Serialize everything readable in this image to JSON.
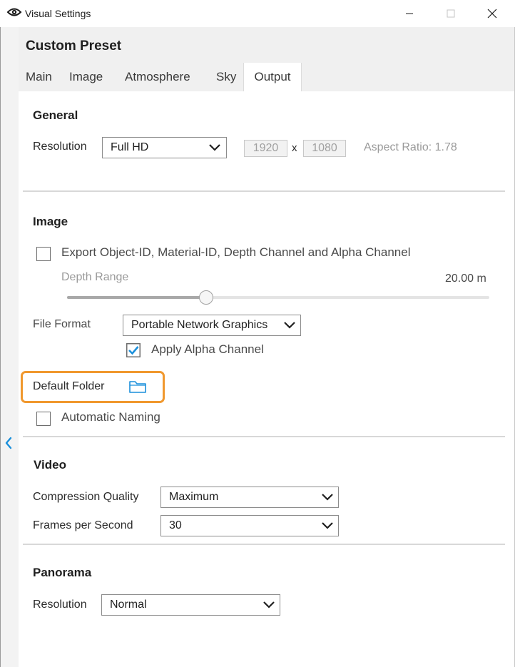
{
  "window": {
    "title": "Visual Settings",
    "icons": {
      "app": "eye-gear-icon",
      "minimize": "minimize-icon",
      "maximize": "maximize-icon",
      "close": "close-icon"
    }
  },
  "header": {
    "preset_title": "Custom Preset"
  },
  "tabs": [
    {
      "label": "Main",
      "active": false
    },
    {
      "label": "Image",
      "active": false
    },
    {
      "label": "Atmosphere",
      "active": false
    },
    {
      "label": "Sky",
      "active": false
    },
    {
      "label": "Output",
      "active": true
    }
  ],
  "general": {
    "heading": "General",
    "resolution_label": "Resolution",
    "resolution_value": "Full HD",
    "width": "1920",
    "times": "x",
    "height": "1080",
    "aspect_ratio": "Aspect Ratio: 1.78"
  },
  "image": {
    "heading": "Image",
    "export_channels_label": "Export Object-ID, Material-ID, Depth Channel and Alpha Channel",
    "export_channels_checked": false,
    "depth_range_label": "Depth Range",
    "depth_range_value": "20.00 m",
    "depth_range_fraction": 0.33,
    "file_format_label": "File Format",
    "file_format_value": "Portable Network Graphics",
    "apply_alpha_label": "Apply Alpha Channel",
    "apply_alpha_checked": true,
    "default_folder_label": "Default Folder",
    "automatic_naming_label": "Automatic Naming",
    "automatic_naming_checked": false
  },
  "video": {
    "heading": "Video",
    "compression_label": "Compression Quality",
    "compression_value": "Maximum",
    "fps_label": "Frames per Second",
    "fps_value": "30"
  },
  "panorama": {
    "heading": "Panorama",
    "resolution_label": "Resolution",
    "resolution_value": "Normal"
  },
  "colors": {
    "accent": "#1a8fdb",
    "highlight": "#f0982e",
    "header_bg": "#f0f0f0"
  }
}
